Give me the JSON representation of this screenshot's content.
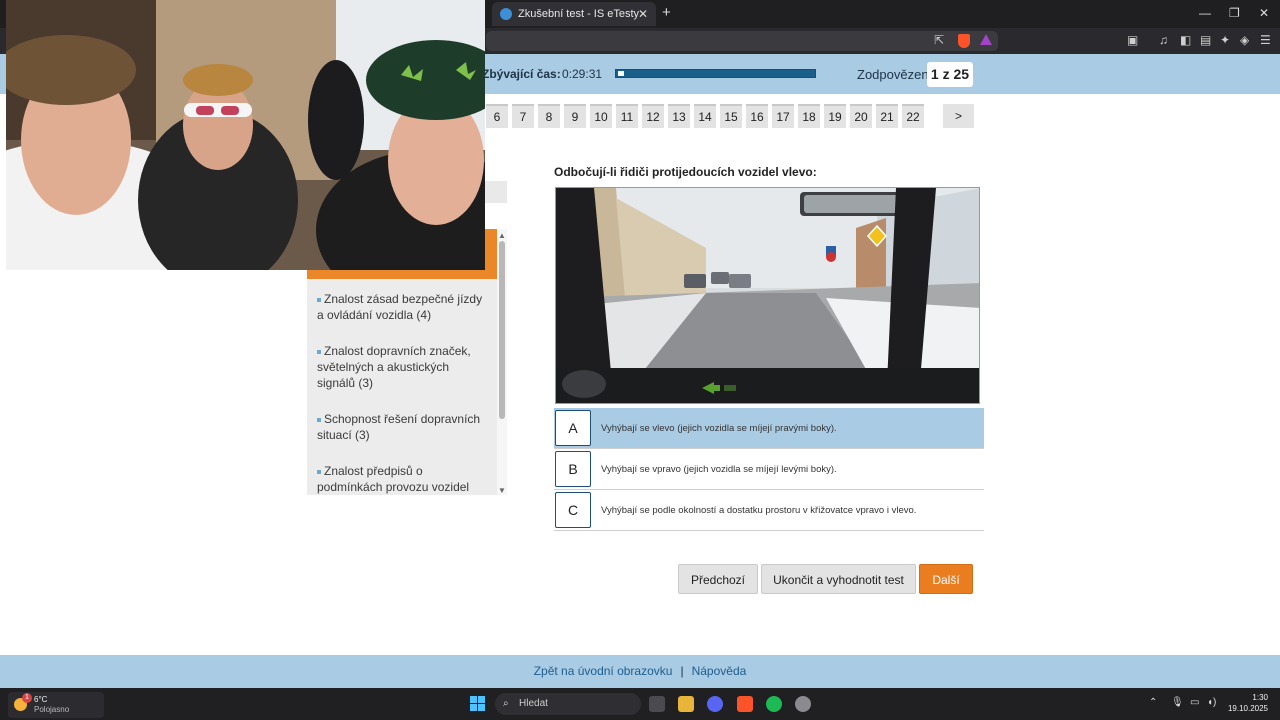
{
  "browser": {
    "tab_title": "Zkušební test - IS eTesty",
    "new_tab": "+",
    "tab_close": "✕",
    "window_min": "—",
    "window_max": "❐",
    "window_close": "✕"
  },
  "timer": {
    "label": "Zbývající čas:",
    "value": "0:29:31",
    "remaining_fraction": 0.03,
    "answered_label": "Zodpovězeno",
    "answered_value": "1 z 25"
  },
  "question_numbers": [
    "6",
    "7",
    "8",
    "9",
    "10",
    "11",
    "12",
    "13",
    "14",
    "15",
    "16",
    "17",
    "18",
    "19",
    "20",
    "21",
    "22"
  ],
  "next_page": ">",
  "sidebar": {
    "items": [
      {
        "label": "Znalost zásad bezpečné jízdy a ovládání vozidla (4)"
      },
      {
        "label": "Znalost dopravních značek, světelných a akustických signálů (3)"
      },
      {
        "label": "Schopnost řešení dopravních situací (3)"
      },
      {
        "label": "Znalost předpisů o podmínkách provozu vozidel (2)"
      }
    ]
  },
  "question": {
    "text": "Odbočují-li řidiči protijedoucích vozidel vlevo:"
  },
  "answers": [
    {
      "letter": "A",
      "text": "Vyhýbají se vlevo (jejich vozidla se míjejí pravými boky).",
      "selected": true
    },
    {
      "letter": "B",
      "text": "Vyhýbají se vpravo (jejich vozidla se míjejí levými boky).",
      "selected": false
    },
    {
      "letter": "C",
      "text": "Vyhýbají se podle okolností a dostatku prostoru v křižovatce vpravo i vlevo.",
      "selected": false
    }
  ],
  "buttons": {
    "prev": "Předchozí",
    "finish": "Ukončit a vyhodnotit test",
    "next": "Další"
  },
  "footer": {
    "home_link": "Zpět na úvodní obrazovku",
    "separator": "|",
    "help_link": "Nápověda"
  },
  "taskbar": {
    "weather_temp": "6°C",
    "weather_desc": "Polojasno",
    "weather_badge": "1",
    "search_placeholder": "Hledat",
    "time": "1:30",
    "date": "19.10.2025"
  },
  "colors": {
    "accent_blue": "#a9cbe4",
    "accent_orange": "#ea7d1f"
  }
}
